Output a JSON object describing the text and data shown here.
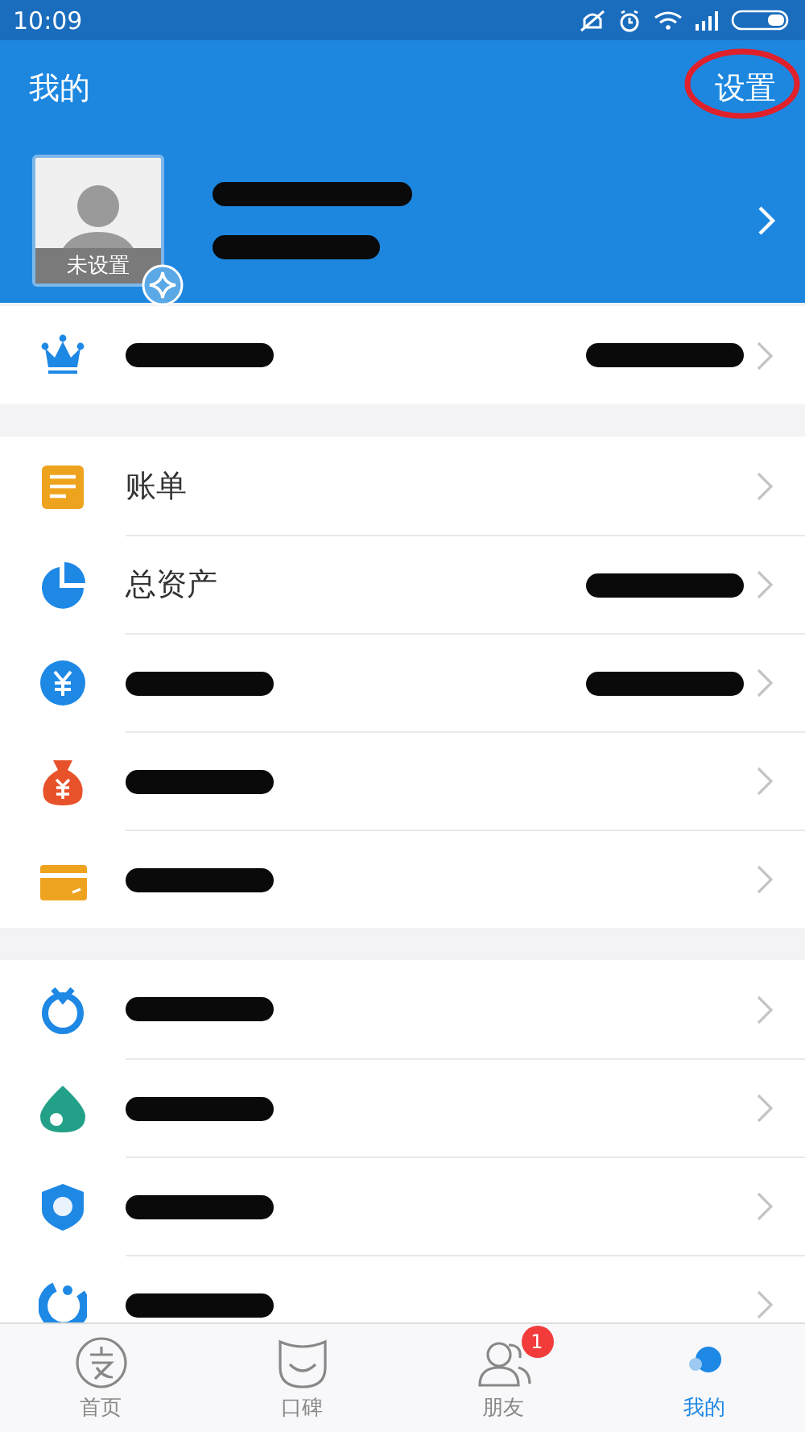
{
  "status_bar": {
    "time": "10:09"
  },
  "header": {
    "title": "我的",
    "settings": "设置",
    "settings_circled": true
  },
  "profile": {
    "avatar_caption": "未设置",
    "name_redacted": true,
    "account_redacted": true
  },
  "sections": [
    [
      {
        "kind": "crown",
        "label_redacted": true,
        "value_redacted": true
      }
    ],
    [
      {
        "kind": "bill",
        "label": "账单",
        "label_redacted": false,
        "value_redacted": false
      },
      {
        "kind": "pie",
        "label": "总资产",
        "label_redacted": false,
        "value_redacted": true
      },
      {
        "kind": "yuan",
        "label_redacted": true,
        "value_redacted": true
      },
      {
        "kind": "bag",
        "label_redacted": true,
        "value_redacted": false
      },
      {
        "kind": "card",
        "label_redacted": true,
        "value_redacted": false
      }
    ],
    [
      {
        "kind": "clock",
        "label_redacted": true,
        "value_redacted": false
      },
      {
        "kind": "drop",
        "label_redacted": true,
        "value_redacted": false
      },
      {
        "kind": "shield",
        "label_redacted": true,
        "value_redacted": false
      },
      {
        "kind": "charity",
        "label_redacted": true,
        "value_redacted": false
      }
    ]
  ],
  "tabs": [
    {
      "kind": "home",
      "label": "首页",
      "selected": false
    },
    {
      "kind": "koubei",
      "label": "口碑",
      "selected": false
    },
    {
      "kind": "friends",
      "label": "朋友",
      "selected": false,
      "badge": "1"
    },
    {
      "kind": "me",
      "label": "我的",
      "selected": true
    }
  ]
}
